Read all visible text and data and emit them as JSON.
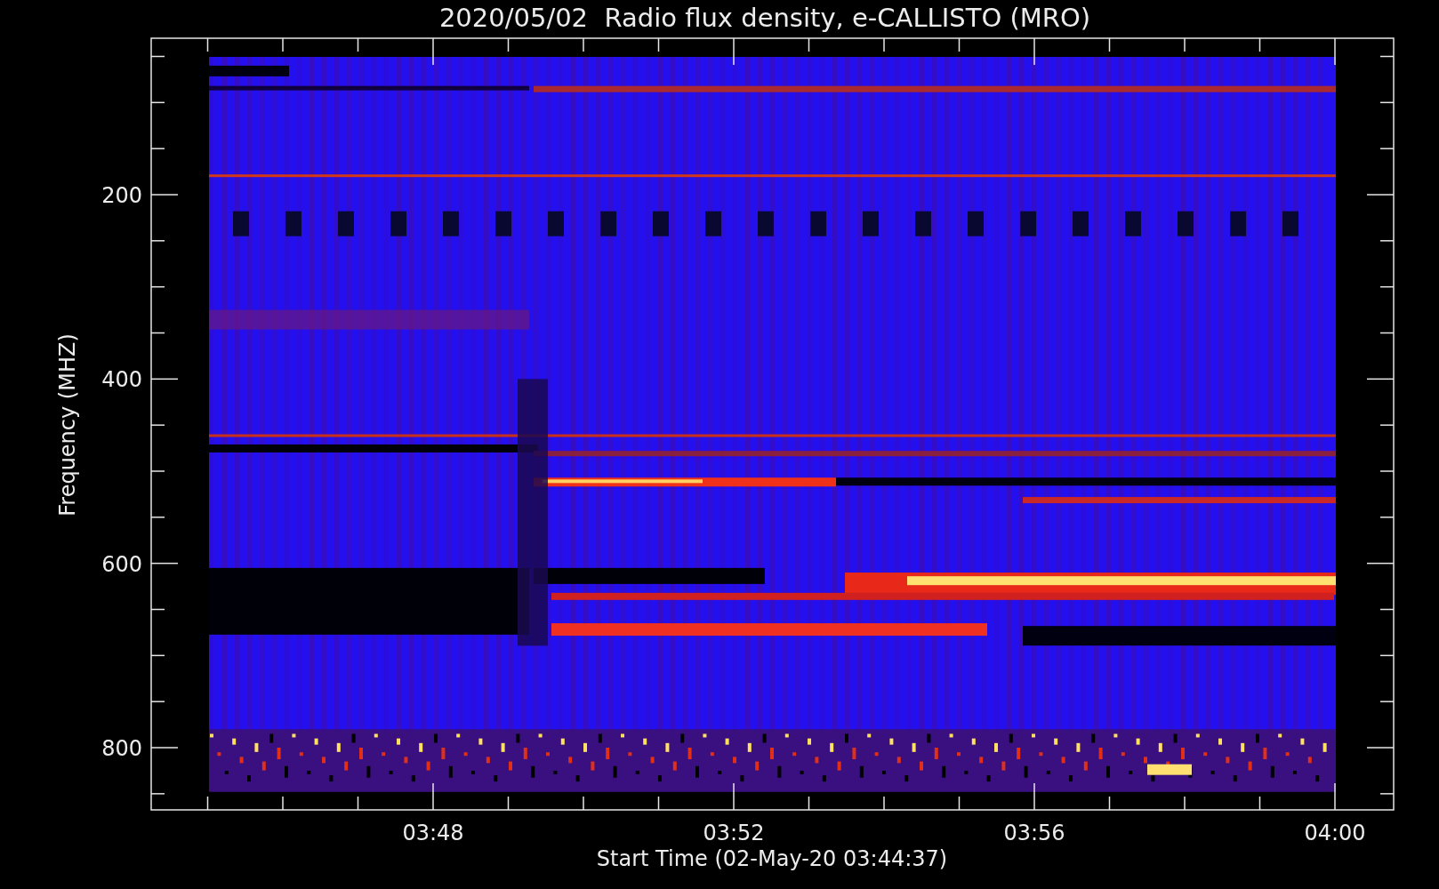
{
  "title": "2020/05/02  Radio flux density, e-CALLISTO (MRO)",
  "y_axis": {
    "label": "Frequency (MHZ)",
    "ticks": [
      "200",
      "400",
      "600",
      "800"
    ]
  },
  "x_axis": {
    "label": "Start Time (02-May-20 03:44:37)",
    "ticks": [
      "03:48",
      "03:52",
      "03:56",
      "04:00"
    ]
  }
}
